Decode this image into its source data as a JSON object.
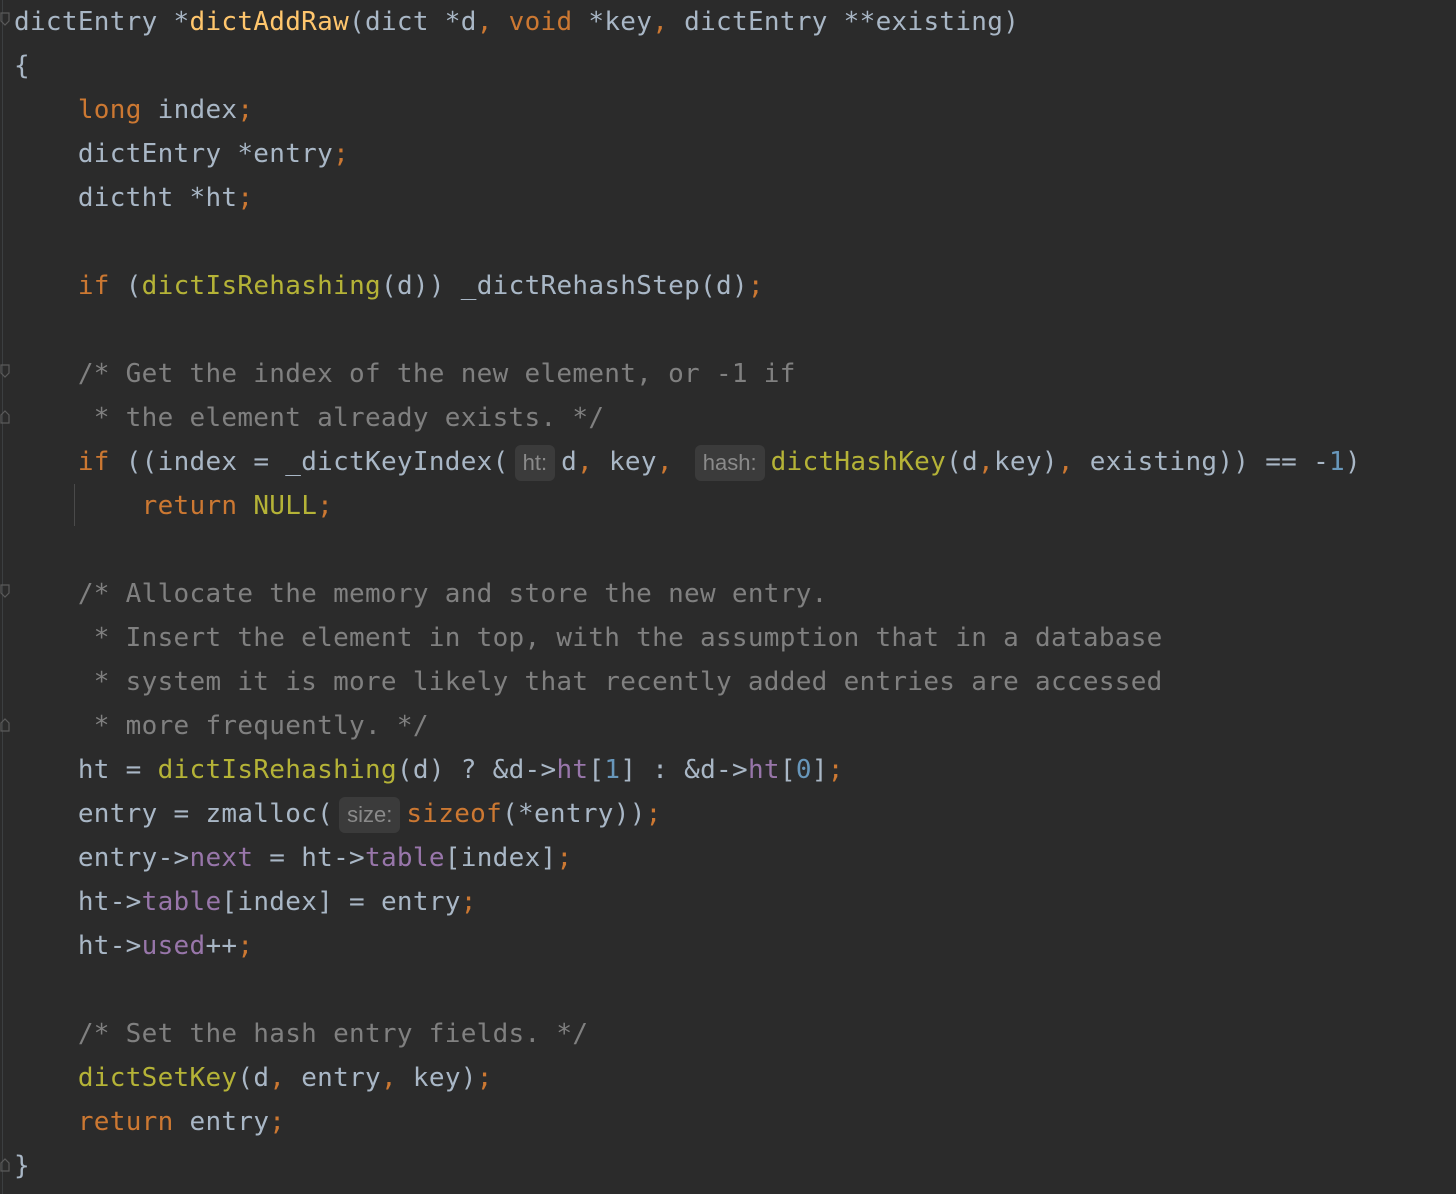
{
  "editor": {
    "theme_colors": {
      "background": "#2b2b2b",
      "plain": "#a9b7c6",
      "keyword": "#cc7832",
      "function_decl": "#ffc66d",
      "function_call": "#b5b337",
      "field": "#9876aa",
      "number": "#6897bb",
      "comment": "#808080"
    },
    "lines": [
      {
        "tokens": [
          {
            "c": "plain",
            "t": "dictEntry *"
          },
          {
            "c": "fn",
            "t": "dictAddRaw"
          },
          {
            "c": "plain",
            "t": "(dict *d"
          },
          {
            "c": "punct",
            "t": ", "
          },
          {
            "c": "kw",
            "t": "void "
          },
          {
            "c": "plain",
            "t": "*key"
          },
          {
            "c": "punct",
            "t": ", "
          },
          {
            "c": "plain",
            "t": "dictEntry **existing)"
          }
        ]
      },
      {
        "tokens": [
          {
            "c": "plain",
            "t": "{"
          }
        ]
      },
      {
        "tokens": [
          {
            "c": "plain",
            "t": "    "
          },
          {
            "c": "kw",
            "t": "long "
          },
          {
            "c": "plain",
            "t": "index"
          },
          {
            "c": "punct",
            "t": ";"
          }
        ]
      },
      {
        "tokens": [
          {
            "c": "plain",
            "t": "    dictEntry *entry"
          },
          {
            "c": "punct",
            "t": ";"
          }
        ]
      },
      {
        "tokens": [
          {
            "c": "plain",
            "t": "    dictht *ht"
          },
          {
            "c": "punct",
            "t": ";"
          }
        ]
      },
      {
        "tokens": []
      },
      {
        "tokens": [
          {
            "c": "plain",
            "t": "    "
          },
          {
            "c": "kw",
            "t": "if "
          },
          {
            "c": "plain",
            "t": "("
          },
          {
            "c": "call",
            "t": "dictIsRehashing"
          },
          {
            "c": "plain",
            "t": "(d)) _dictRehashStep(d)"
          },
          {
            "c": "punct",
            "t": ";"
          }
        ]
      },
      {
        "tokens": []
      },
      {
        "tokens": [
          {
            "c": "comment",
            "t": "    /* Get the index of the new element, or -1 if"
          }
        ]
      },
      {
        "tokens": [
          {
            "c": "comment",
            "t": "     * the element already exists. */"
          }
        ]
      },
      {
        "tokens": [
          {
            "c": "plain",
            "t": "    "
          },
          {
            "c": "kw",
            "t": "if "
          },
          {
            "c": "plain",
            "t": "((index = _dictKeyIndex("
          },
          {
            "c": "hint",
            "t": "ht:"
          },
          {
            "c": "plain",
            "t": "d"
          },
          {
            "c": "punct",
            "t": ", "
          },
          {
            "c": "plain",
            "t": "key"
          },
          {
            "c": "punct",
            "t": ", "
          },
          {
            "c": "hint",
            "t": "hash:"
          },
          {
            "c": "call",
            "t": "dictHashKey"
          },
          {
            "c": "plain",
            "t": "(d"
          },
          {
            "c": "punct",
            "t": ","
          },
          {
            "c": "plain",
            "t": "key)"
          },
          {
            "c": "punct",
            "t": ", "
          },
          {
            "c": "plain",
            "t": "existing)) == -"
          },
          {
            "c": "num",
            "t": "1"
          },
          {
            "c": "plain",
            "t": ")"
          }
        ]
      },
      {
        "tokens": [
          {
            "c": "plain",
            "t": "        "
          },
          {
            "c": "kw",
            "t": "return "
          },
          {
            "c": "call",
            "t": "NULL"
          },
          {
            "c": "punct",
            "t": ";"
          }
        ]
      },
      {
        "tokens": []
      },
      {
        "tokens": [
          {
            "c": "comment",
            "t": "    /* Allocate the memory and store the new entry."
          }
        ]
      },
      {
        "tokens": [
          {
            "c": "comment",
            "t": "     * Insert the element in top, with the assumption that in a database"
          }
        ]
      },
      {
        "tokens": [
          {
            "c": "comment",
            "t": "     * system it is more likely that recently added entries are accessed"
          }
        ]
      },
      {
        "tokens": [
          {
            "c": "comment",
            "t": "     * more frequently. */"
          }
        ]
      },
      {
        "tokens": [
          {
            "c": "plain",
            "t": "    ht = "
          },
          {
            "c": "call",
            "t": "dictIsRehashing"
          },
          {
            "c": "plain",
            "t": "(d) ? &d->"
          },
          {
            "c": "field",
            "t": "ht"
          },
          {
            "c": "plain",
            "t": "["
          },
          {
            "c": "num",
            "t": "1"
          },
          {
            "c": "plain",
            "t": "] : &d->"
          },
          {
            "c": "field",
            "t": "ht"
          },
          {
            "c": "plain",
            "t": "["
          },
          {
            "c": "num",
            "t": "0"
          },
          {
            "c": "plain",
            "t": "]"
          },
          {
            "c": "punct",
            "t": ";"
          }
        ]
      },
      {
        "tokens": [
          {
            "c": "plain",
            "t": "    entry = zmalloc("
          },
          {
            "c": "hint",
            "t": "size:"
          },
          {
            "c": "kw",
            "t": "sizeof"
          },
          {
            "c": "plain",
            "t": "(*entry))"
          },
          {
            "c": "punct",
            "t": ";"
          }
        ]
      },
      {
        "tokens": [
          {
            "c": "plain",
            "t": "    entry->"
          },
          {
            "c": "field",
            "t": "next"
          },
          {
            "c": "plain",
            "t": " = ht->"
          },
          {
            "c": "field",
            "t": "table"
          },
          {
            "c": "plain",
            "t": "[index]"
          },
          {
            "c": "punct",
            "t": ";"
          }
        ]
      },
      {
        "tokens": [
          {
            "c": "plain",
            "t": "    ht->"
          },
          {
            "c": "field",
            "t": "table"
          },
          {
            "c": "plain",
            "t": "[index] = entry"
          },
          {
            "c": "punct",
            "t": ";"
          }
        ]
      },
      {
        "tokens": [
          {
            "c": "plain",
            "t": "    ht->"
          },
          {
            "c": "field",
            "t": "used"
          },
          {
            "c": "plain",
            "t": "++"
          },
          {
            "c": "punct",
            "t": ";"
          }
        ]
      },
      {
        "tokens": []
      },
      {
        "tokens": [
          {
            "c": "comment",
            "t": "    /* Set the hash entry fields. */"
          }
        ]
      },
      {
        "tokens": [
          {
            "c": "plain",
            "t": "    "
          },
          {
            "c": "call",
            "t": "dictSetKey"
          },
          {
            "c": "plain",
            "t": "(d"
          },
          {
            "c": "punct",
            "t": ", "
          },
          {
            "c": "plain",
            "t": "entry"
          },
          {
            "c": "punct",
            "t": ", "
          },
          {
            "c": "plain",
            "t": "key)"
          },
          {
            "c": "punct",
            "t": ";"
          }
        ]
      },
      {
        "tokens": [
          {
            "c": "plain",
            "t": "    "
          },
          {
            "c": "kw",
            "t": "return "
          },
          {
            "c": "plain",
            "t": "entry"
          },
          {
            "c": "punct",
            "t": ";"
          }
        ]
      },
      {
        "tokens": [
          {
            "c": "plain",
            "t": "}"
          }
        ]
      }
    ]
  }
}
